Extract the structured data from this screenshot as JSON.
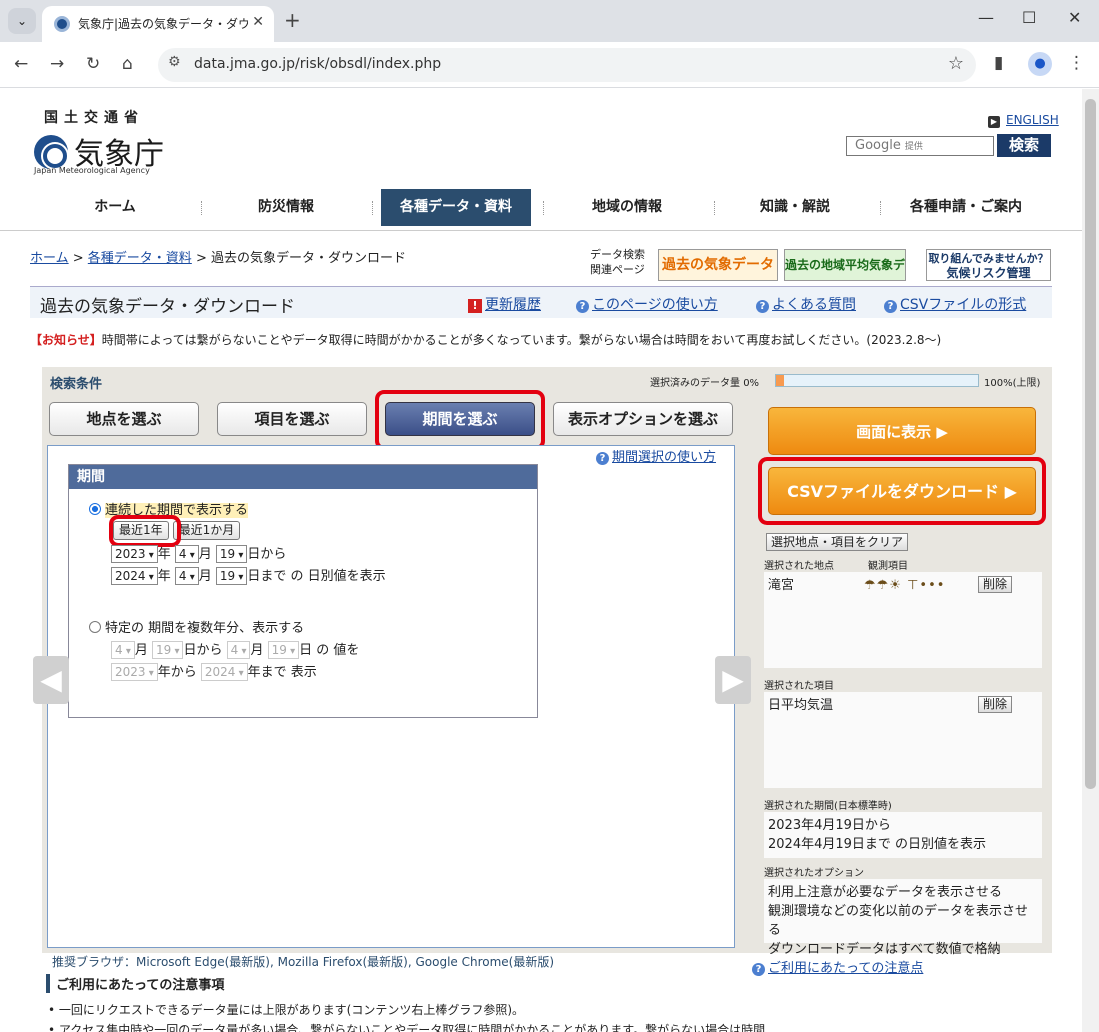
{
  "browser": {
    "tab_title": "気象庁|過去の気象データ・ダウンロ",
    "url": "data.jma.go.jp/risk/obsdl/index.php"
  },
  "header": {
    "ministry": "国土交通省",
    "agency": "気象庁",
    "agency_en": "Japan Meteorological Agency",
    "english_link": "ENGLISH",
    "search_placeholder": "Google",
    "search_provider": "提供",
    "search_button": "検索"
  },
  "gnav": [
    "ホーム",
    "防災情報",
    "各種データ・資料",
    "地域の情報",
    "知識・解説",
    "各種申請・ご案内"
  ],
  "breadcrumb": {
    "home": "ホーム",
    "data": "各種データ・資料",
    "current": "過去の気象データ・ダウンロード"
  },
  "related": {
    "label1": "データ検索",
    "label2": "関連ページ",
    "banner1": "過去の気象データ検索",
    "banner2": "過去の地域平均気象データ検索",
    "banner3_line1": "取り組んでみませんか？",
    "banner3_line2": "気候リスク管理"
  },
  "title": {
    "main": "過去の気象データ・ダウンロード",
    "history": "更新履歴",
    "howto": "このページの使い方",
    "faq": "よくある質問",
    "csvformat": "CSVファイルの形式"
  },
  "notice": {
    "tag": "【お知らせ】",
    "text": "時間帯によっては繋がらないことやデータ取得に時間がかかることが多くなっています。繋がらない場合は時間をおいて再度お試しください。(2023.2.8～)"
  },
  "panel": {
    "cond_label": "検索条件",
    "datavol_label": "選択済みのデータ量",
    "datavol_min": "0%",
    "datavol_max": "100%(上限)",
    "datavol_fraction": 0.04,
    "tabs": [
      "地点を選ぶ",
      "項目を選ぶ",
      "期間を選ぶ",
      "表示オプションを選ぶ"
    ],
    "usage_link": "期間選択の使い方"
  },
  "period": {
    "header": "期間",
    "opt1": "連続した期間で表示する",
    "btn_year": "最近1年",
    "btn_month": "最近1か月",
    "from_year": "2023",
    "from_month": "4",
    "from_day": "19",
    "to_year": "2024",
    "to_month": "4",
    "to_day": "19",
    "u_year": "年",
    "u_month": "月",
    "u_from": "日から",
    "u_to": "日まで",
    "to_suffix": "の 日別値を表示",
    "opt2": "特定の 期間を複数年分、表示する",
    "opt2_from_month": "4",
    "opt2_from_day": "19",
    "opt2_to_month": "4",
    "opt2_to_day": "19",
    "opt2_from_suffix": "日から",
    "opt2_to_suffix": "日 の 値を",
    "opt2_year_from": "2023",
    "opt2_year_to": "2024",
    "opt2_year_from_suffix": "年から",
    "opt2_year_to_suffix": "年まで 表示"
  },
  "side": {
    "show_button": "画面に表示 ▶",
    "csv_button": "CSVファイルをダウンロード ▶",
    "clear_button": "選択地点・項目をクリア",
    "stations_label": "選択された地点",
    "obs_label": "観測項目",
    "station": "滝宮",
    "obs_icons": "☂☂☀   ⊤•••",
    "delete": "削除",
    "items_label": "選択された項目",
    "item": "日平均気温",
    "period_label": "選択された期間(日本標準時)",
    "period_line1": "2023年4月19日から",
    "period_line2": "2024年4月19日まで の日別値を表示",
    "options_label": "選択されたオプション",
    "options": [
      "利用上注意が必要なデータを表示させる",
      "観測環境などの変化以前のデータを表示させる",
      "ダウンロードデータはすべて数値で格納"
    ]
  },
  "footer": {
    "browser_note": "推奨ブラウザ：Microsoft Edge(最新版), Mozilla Firefox(最新版), Google Chrome(最新版)",
    "caution_link": "ご利用にあたっての注意点",
    "caution_heading": "ご利用にあたっての注意事項",
    "items": [
      "一回にリクエストできるデータ量には上限があります(コンテンツ右上棒グラフ参照)。",
      "アクセス集中時や一回のデータ量が多い場合、繋がらないことやデータ取得に時間がかかることがあります。繋がらない場合は時間"
    ]
  }
}
